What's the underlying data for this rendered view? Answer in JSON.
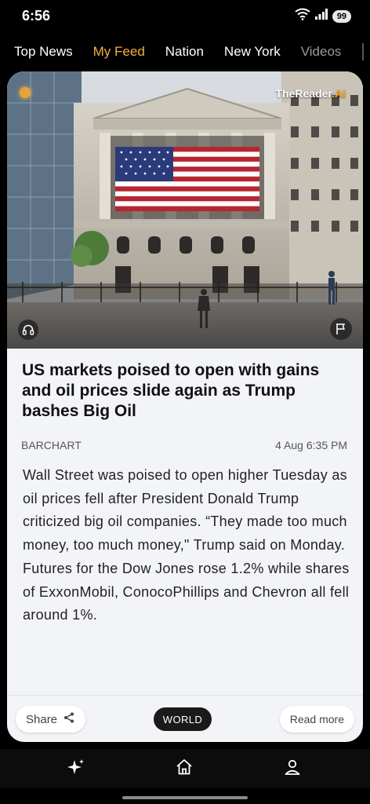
{
  "status": {
    "time": "6:56",
    "battery": "99",
    "icons": [
      "wifi-icon",
      "signal-icon",
      "battery-icon"
    ]
  },
  "nav": {
    "tabs": [
      {
        "label": "Top News",
        "active": false
      },
      {
        "label": "My Feed",
        "active": true
      },
      {
        "label": "Nation",
        "active": false
      },
      {
        "label": "New York",
        "active": false
      },
      {
        "label": "Videos",
        "active": false
      }
    ]
  },
  "article": {
    "watermark_main": "TheReader",
    "watermark_suffix": ".AI",
    "headline": "US markets poised to open with gains and oil prices slide again as Trump bashes Big Oil",
    "source": "BARCHART",
    "timestamp": "4 Aug 6:35 PM",
    "body": "Wall Street was poised to open higher Tuesday as oil prices fell after President Donald Trump criticized big oil companies. “They made too much money, too much money,\" Trump said on Monday. Futures for the Dow Jones rose 1.2% while shares of ExxonMobil, ConocoPhillips and Chevron all fell around 1%.",
    "image_icons": [
      "headphones-icon",
      "flag-icon"
    ]
  },
  "footer": {
    "share_label": "Share",
    "category": "WORLD",
    "read_more_label": "Read more"
  },
  "bottom_nav": {
    "items": [
      "sparkle-icon",
      "home-icon",
      "profile-icon"
    ]
  },
  "colors": {
    "accent": "#f5b041",
    "card_bg": "#f3f4f8",
    "brand_ai": "#f5a623"
  }
}
